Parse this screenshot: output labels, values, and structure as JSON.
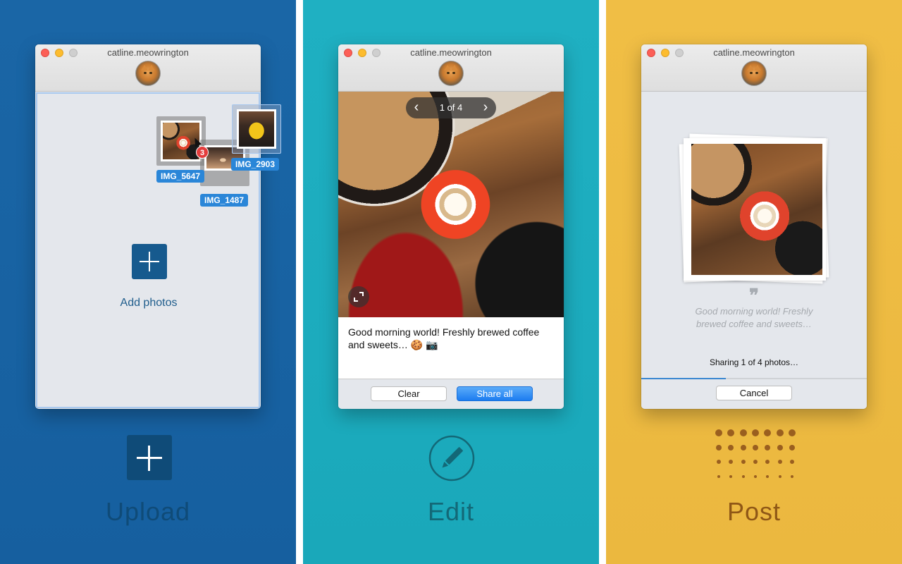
{
  "colors": {
    "upload_bg": "#1a66a6",
    "edit_bg": "#1fb0c2",
    "post_bg": "#f0be45",
    "upload_label": "#0f4b78",
    "edit_label": "#136877",
    "post_label": "#8f5716",
    "accent_blue": "#2a86d8"
  },
  "panels": [
    {
      "step_label": "Upload",
      "step_icon": "plus-square-icon",
      "window": {
        "title": "catline.meowrington",
        "drop_area": {
          "add_label": "Add photos",
          "dragged_files": [
            {
              "name": "IMG_5647"
            },
            {
              "name": "IMG_1487"
            },
            {
              "name": "IMG_2903"
            }
          ],
          "drag_count_badge": "3"
        }
      }
    },
    {
      "step_label": "Edit",
      "step_icon": "pencil-circle-icon",
      "window": {
        "title": "catline.meowrington",
        "pager": {
          "text": "1 of 4",
          "prev": "‹",
          "next": "›"
        },
        "caption": "Good morning world! Freshly brewed coffee and sweets… 🍪 📷",
        "buttons": {
          "clear": "Clear",
          "share": "Share all"
        }
      }
    },
    {
      "step_label": "Post",
      "step_icon": "dot-grid-icon",
      "window": {
        "title": "catline.meowrington",
        "quote_mark": "❞",
        "quote": "Good morning world! Freshly brewed coffee and sweets…",
        "status": "Sharing 1 of 4 photos…",
        "progress": 0.375,
        "buttons": {
          "cancel": "Cancel"
        }
      }
    }
  ]
}
